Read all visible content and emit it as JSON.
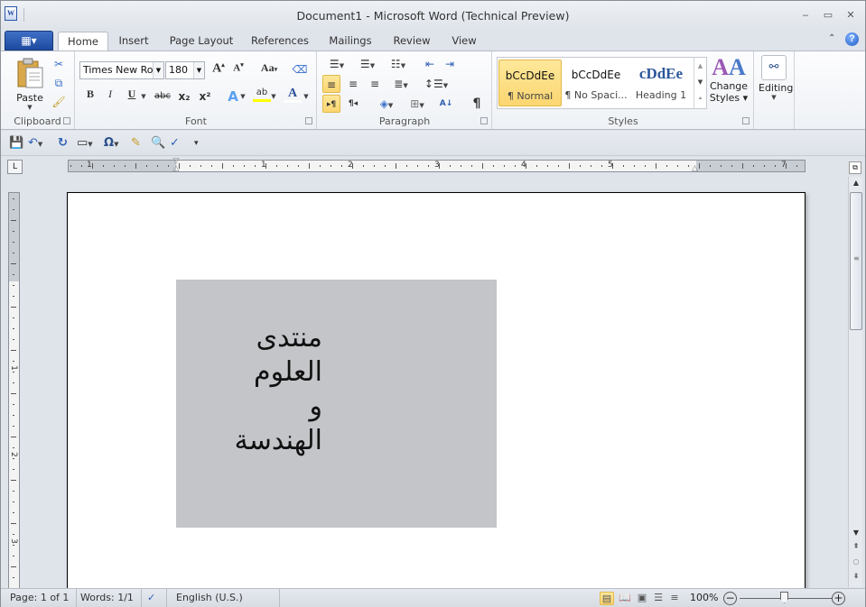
{
  "window": {
    "title": "Document1  -  Microsoft Word (Technical Preview)",
    "app_icon": "W",
    "controls": {
      "minimize": "‒",
      "restore": "▭",
      "close": "✕"
    }
  },
  "ribbon_tabs": {
    "file_icon": "▦▾",
    "items": [
      "Home",
      "Insert",
      "Page Layout",
      "References",
      "Mailings",
      "Review",
      "View"
    ],
    "active": "Home",
    "collapse_icon": "⌃",
    "help_icon": "?"
  },
  "clipboard": {
    "paste": "Paste",
    "label": "Clipboard"
  },
  "font": {
    "name": "Times New Roman",
    "size": "180",
    "label": "Font",
    "grow": "A",
    "shrink": "A",
    "change_case": "Aa",
    "bold": "B",
    "italic": "I",
    "underline": "U",
    "strikethrough": "abc",
    "subscript": "x₂",
    "superscript": "x²",
    "text_effects": "A",
    "highlight": "ab",
    "font_color": "A",
    "highlight_color": "#ffff00",
    "font_color_bar": "#c00000"
  },
  "paragraph": {
    "label": "Paragraph",
    "show_marks": "¶",
    "ltr": "▸¶",
    "rtl": "¶◂",
    "sort": "A↓"
  },
  "styles": {
    "label": "Styles",
    "items": [
      {
        "preview": "bCcDdEe",
        "name": "¶ Normal",
        "selected": true
      },
      {
        "preview": "bCcDdEe",
        "name": "¶ No Spaci..."
      },
      {
        "preview": "cDdEe",
        "name": "Heading 1"
      }
    ],
    "change_styles": [
      "Change",
      "Styles ▾"
    ]
  },
  "editing": {
    "label": "Editing"
  },
  "qat": {
    "items": [
      "save",
      "undo",
      "redo",
      "text-box",
      "symbol",
      "table",
      "print-preview",
      "spelling",
      "customize"
    ]
  },
  "ruler": {
    "h_labels": [
      "1",
      "1",
      "2",
      "3",
      "4",
      "5",
      "7"
    ],
    "v_labels": [
      "1",
      "2",
      "3"
    ],
    "tab_selector": "L"
  },
  "document": {
    "textbox_lines": [
      "منتدى",
      "العلوم",
      "و",
      "الهندسة"
    ]
  },
  "statusbar": {
    "page": "Page: 1 of 1",
    "words": "Words: 1/1",
    "language": "English (U.S.)",
    "zoom": "100%",
    "zoom_out": "−",
    "zoom_in": "+"
  }
}
